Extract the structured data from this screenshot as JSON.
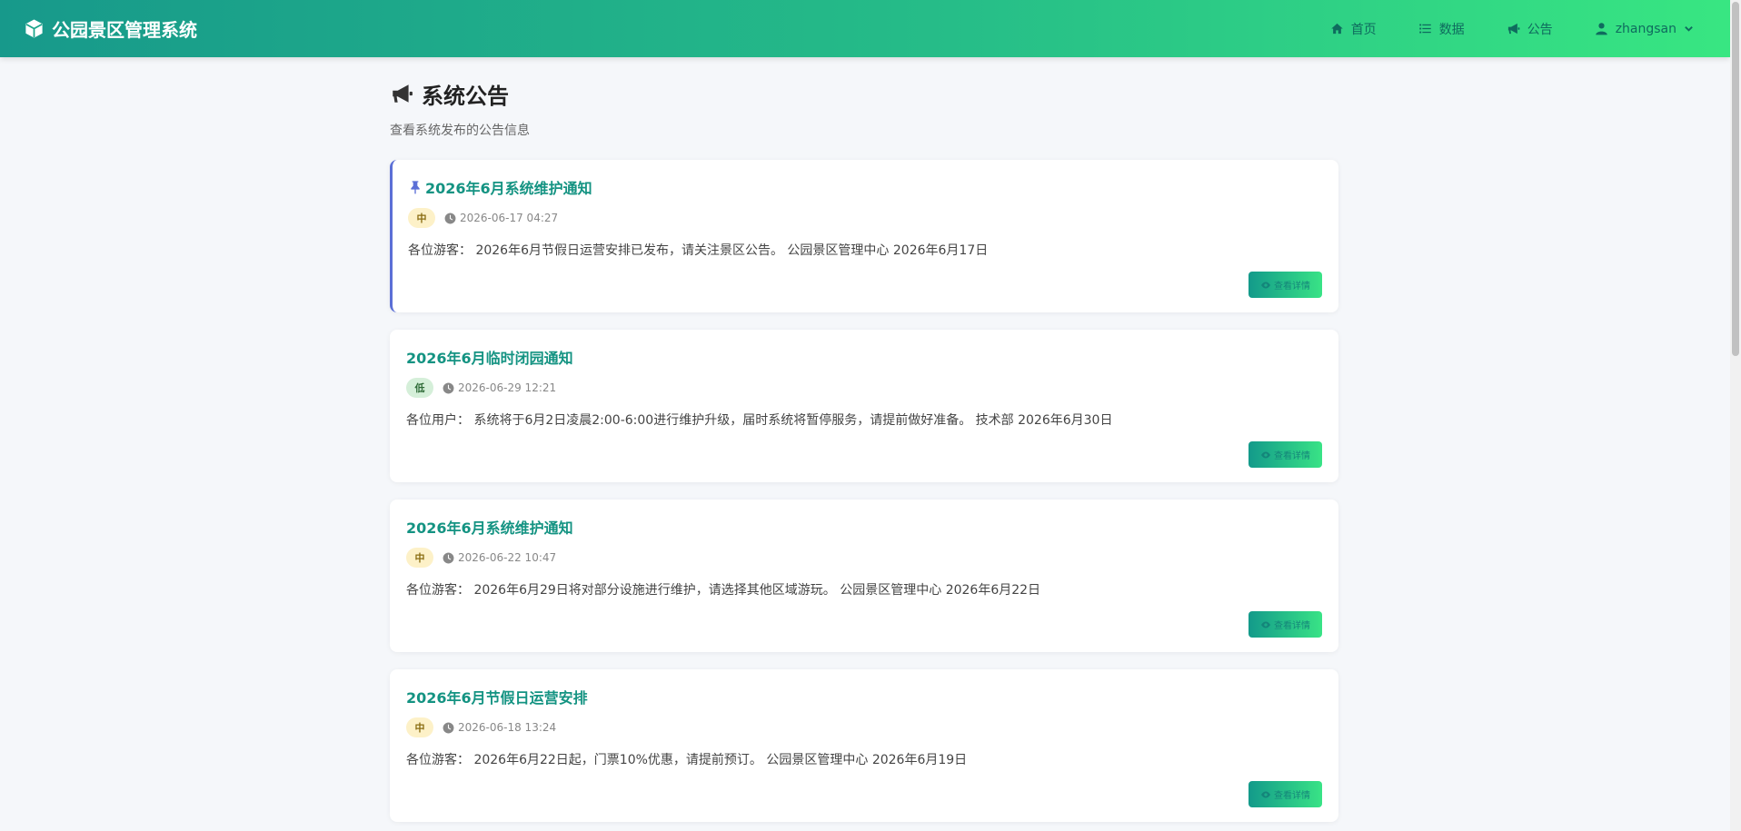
{
  "header": {
    "brand": "公园景区管理系统",
    "nav": {
      "home": "首页",
      "data": "数据",
      "notice": "公告",
      "user": "zhangsan"
    }
  },
  "page": {
    "title": "系统公告",
    "subtitle": "查看系统发布的公告信息"
  },
  "notices": [
    {
      "title": "2026年6月系统维护通知",
      "priority": "中",
      "date": "2026-06-17 04:27",
      "content": "各位游客： 2026年6月节假日运营安排已发布，请关注景区公告。 公园景区管理中心 2026年6月17日",
      "button": "查看详情",
      "pinned": true
    },
    {
      "title": "2026年6月临时闭园通知",
      "priority": "低",
      "date": "2026-06-29 12:21",
      "content": "各位用户： 系统将于6月2日凌晨2:00-6:00进行维护升级，届时系统将暂停服务，请提前做好准备。 技术部 2026年6月30日",
      "button": "查看详情",
      "pinned": false
    },
    {
      "title": "2026年6月系统维护通知",
      "priority": "中",
      "date": "2026-06-22 10:47",
      "content": "各位游客： 2026年6月29日将对部分设施进行维护，请选择其他区域游玩。 公园景区管理中心 2026年6月22日",
      "button": "查看详情",
      "pinned": false
    },
    {
      "title": "2026年6月节假日运营安排",
      "priority": "中",
      "date": "2026-06-18 13:24",
      "content": "各位游客： 2026年6月22日起，门票10%优惠，请提前预订。 公园景区管理中心 2026年6月19日",
      "button": "查看详情",
      "pinned": false
    }
  ],
  "colors": {
    "header_start": "#17998b",
    "header_end": "#38e682",
    "title_green": "#149382",
    "pin_blue": "#5b6fd6",
    "badge_mid": "#fdf1c8",
    "badge_low": "#d5efd9"
  },
  "icons": {
    "brand": "cube-icon",
    "home": "home-icon",
    "data": "list-icon",
    "notice": "bullhorn-icon",
    "user": "user-icon",
    "pin": "thumbtack-icon",
    "clock": "clock-icon",
    "view": "eye-icon"
  }
}
